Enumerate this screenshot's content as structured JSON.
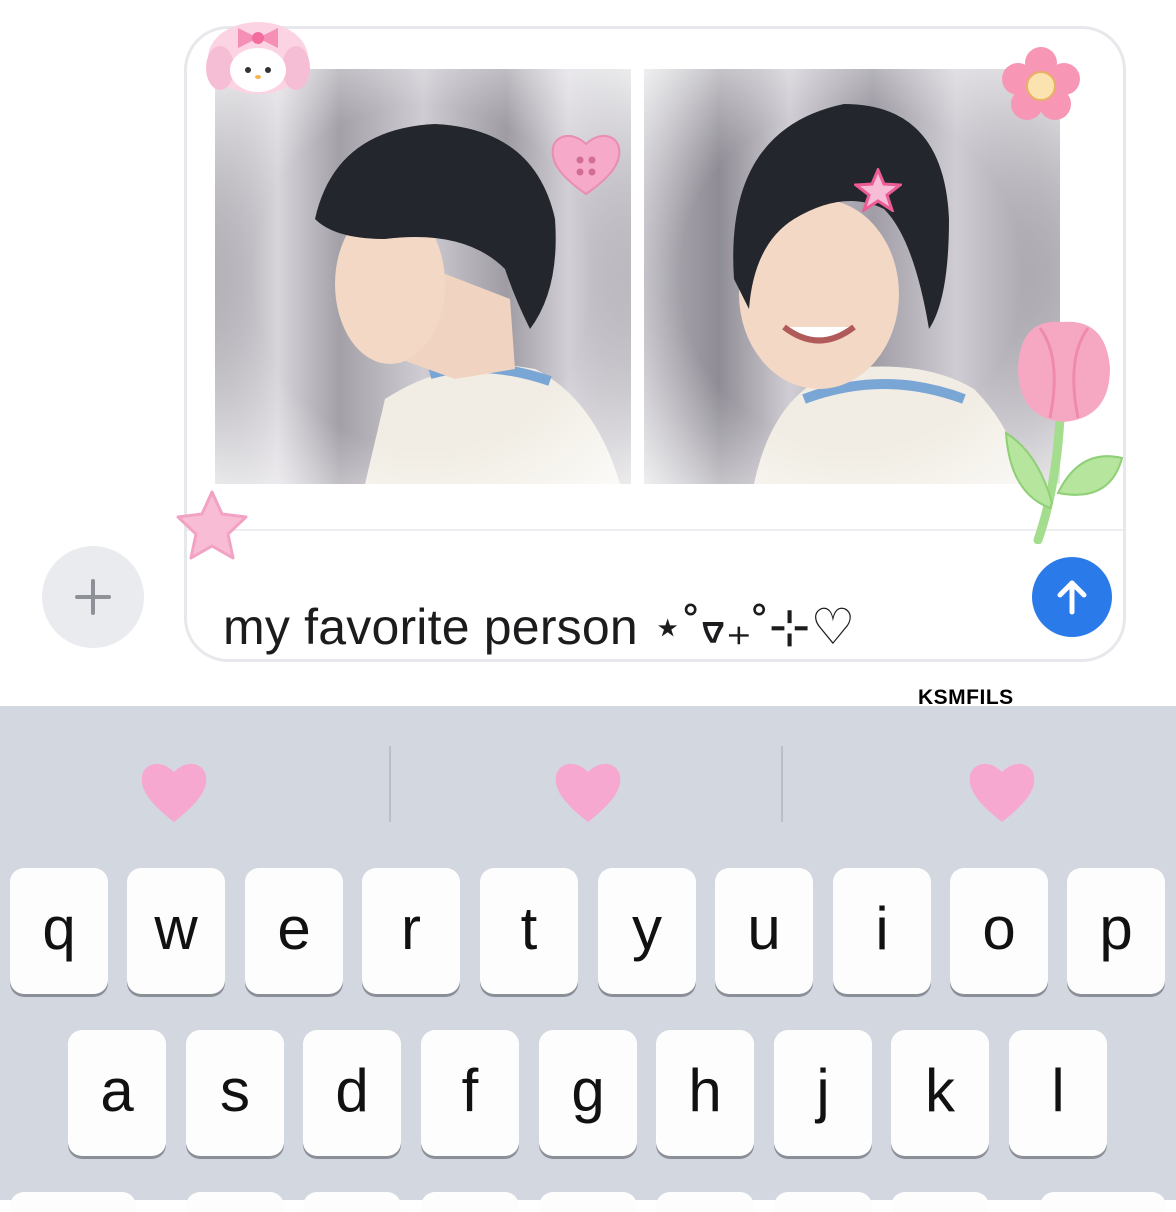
{
  "compose": {
    "message_text": "my favorite person ⋆˚ᢦ₊˚⊹♡",
    "watermark": "KSMFILS"
  },
  "stickers": [
    "melody-plush-icon",
    "heart-button-icon",
    "pink-flower-icon",
    "pink-tulip-icon",
    "pink-star-icon",
    "hair-clip-star-icon"
  ],
  "keyboard": {
    "suggestions": [
      "heart-emoji",
      "heart-emoji",
      "heart-emoji"
    ],
    "row1": [
      "q",
      "w",
      "e",
      "r",
      "t",
      "y",
      "u",
      "i",
      "o",
      "p"
    ],
    "row2": [
      "a",
      "s",
      "d",
      "f",
      "g",
      "h",
      "j",
      "k",
      "l"
    ]
  },
  "colors": {
    "send_button": "#2a7ae9",
    "keyboard_bg": "#d3d7e0",
    "heart_pink": "#f7a8d0"
  }
}
